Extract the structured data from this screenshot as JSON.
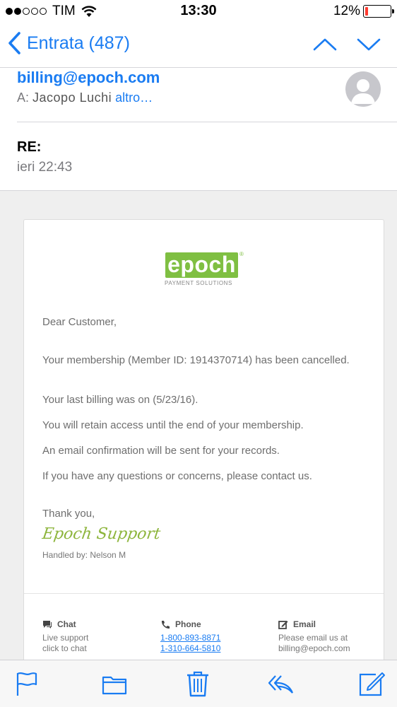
{
  "status_bar": {
    "carrier": "TIM",
    "time": "13:30",
    "battery_percent": "12%",
    "battery_level": 0.12,
    "signal_bars_filled": 2,
    "signal_bars_total": 5
  },
  "nav": {
    "back_label": "Entrata (487)",
    "accent_color": "#1a7cf2"
  },
  "header": {
    "from": "billing@epoch.com",
    "to_prefix": "A:",
    "to_name": "Jacopo Luchi",
    "to_more": "altro…",
    "subject": "RE:",
    "date": "ieri 22:43"
  },
  "email": {
    "logo_text": "epoch",
    "logo_registered": "®",
    "logo_subtitle": "PAYMENT SOLUTIONS",
    "greeting": "Dear Customer,",
    "paragraphs": [
      "Your membership (Member ID: 1914370714) has been cancelled.",
      "Your last billing was on (5/23/16).",
      "You will retain access until the end of your membership.",
      "An email confirmation will be sent for your records.",
      "If you have any questions or concerns, please contact us."
    ],
    "closing": "Thank you,",
    "signature": "Epoch Support",
    "handled_by": "Handled by: Nelson M",
    "brand_color": "#7fbf42"
  },
  "contact": {
    "chat": {
      "title": "Chat",
      "line1": "Live support",
      "line2": "click to chat"
    },
    "phone": {
      "title": "Phone",
      "number1": "1-800-893-8871",
      "number2": "1-310-664-5810"
    },
    "email": {
      "title": "Email",
      "line1": "Please email us at",
      "line2": "billing@epoch.com"
    }
  },
  "toolbar": {
    "icons": [
      "flag-icon",
      "folder-icon",
      "trash-icon",
      "reply-icon",
      "compose-icon"
    ],
    "trash_color": "#1a7cf2"
  }
}
